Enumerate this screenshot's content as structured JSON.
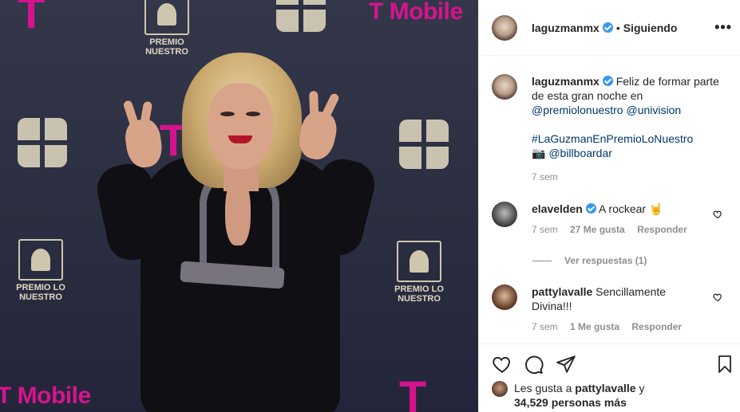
{
  "post": {
    "author": "laguzmanmx",
    "follow_status": "Siguiendo",
    "more_icon": "more-icon",
    "photo_bg_texts": {
      "brand_a": "T",
      "brand_b": "T Mobile",
      "event_line1": "PREMIO",
      "event_line2": "NUESTRO",
      "event_line_lo": "LO",
      "footer_brand": "T Mobile"
    }
  },
  "caption": {
    "author": "laguzmanmx",
    "text_1": "Feliz de formar parte de esta gran noche en",
    "mention_1": "@premiolonuestro",
    "mention_2": "@univision",
    "hashtag": "#LaGuzmanEnPremioLoNuestro",
    "camera_emoji": "📷",
    "mention_3": "@billboardar",
    "time": "7 sem"
  },
  "comments": [
    {
      "user": "elavelden",
      "verified": true,
      "text": "A rockear 🤘",
      "time": "7 sem",
      "likes": "27 Me gusta",
      "reply": "Responder",
      "view_replies": "Ver respuestas (1)"
    },
    {
      "user": "pattylavalle",
      "verified": false,
      "text": "Sencillamente Divina!!!",
      "time": "7 sem",
      "likes": "1 Me gusta",
      "reply": "Responder"
    }
  ],
  "likes_summary": {
    "prefix": "Les gusta a",
    "user": "pattylavalle",
    "suffix": "y",
    "count": "34,529 personas más"
  },
  "colors": {
    "verified": "#3897f0",
    "link": "#00376b",
    "muted": "#8e8e8e",
    "tmobile": "#d6138d"
  }
}
